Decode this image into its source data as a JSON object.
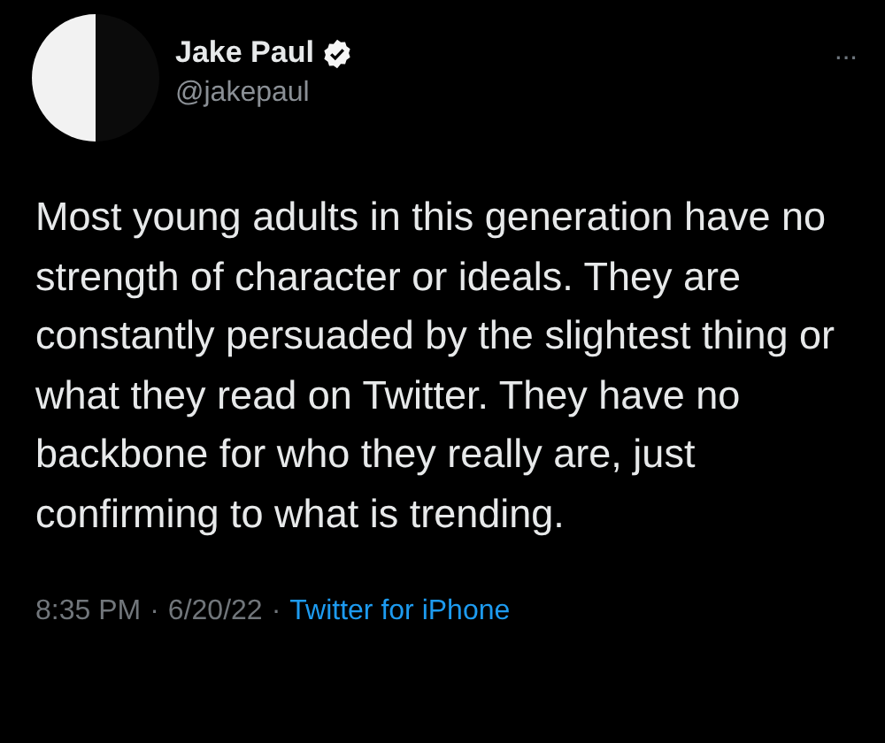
{
  "author": {
    "name": "Jake Paul",
    "verified": true,
    "handle": "@jakepaul"
  },
  "more_menu": "···",
  "text": "Most young adults in this generation have no strength of character or ideals. They are constantly persuaded by the slightest thing or what they read on Twitter. They have no backbone for who they really are, just confirming to what is trending.",
  "footer": {
    "time": "8:35 PM",
    "separator": "·",
    "date": "6/20/22",
    "source": "Twitter for iPhone"
  }
}
